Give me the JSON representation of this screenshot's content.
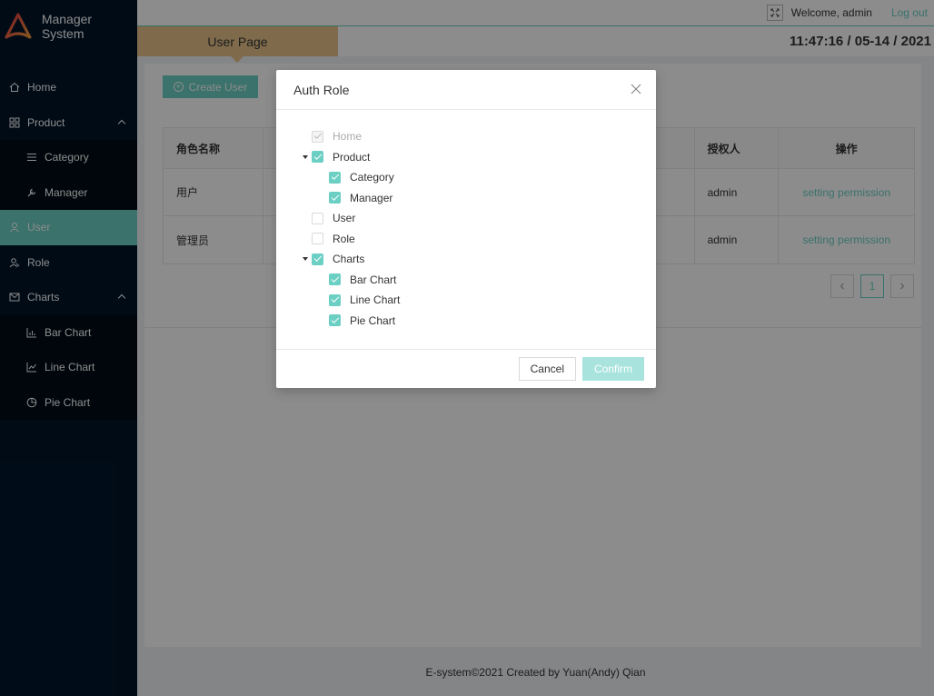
{
  "app": {
    "title": "Manager System"
  },
  "header": {
    "welcome": "Welcome, admin",
    "logout": "Log out",
    "page_title": "User Page",
    "clock": "11:47:16 / 05-14 / 2021"
  },
  "sidebar": {
    "items": [
      {
        "label": "Home"
      },
      {
        "label": "Product"
      },
      {
        "label": "Category"
      },
      {
        "label": "Manager"
      },
      {
        "label": "User"
      },
      {
        "label": "Role"
      },
      {
        "label": "Charts"
      },
      {
        "label": "Bar Chart"
      },
      {
        "label": "Line Chart"
      },
      {
        "label": "Pie Chart"
      }
    ]
  },
  "content": {
    "create_label": "Create User",
    "table": {
      "headers": [
        "角色名称",
        "授权人",
        "操作"
      ],
      "rows": [
        {
          "name": "用户",
          "auth": "admin",
          "action": "setting permission"
        },
        {
          "name": "管理员",
          "auth": "admin",
          "action": "setting permission"
        }
      ]
    },
    "pagination": {
      "current": "1"
    }
  },
  "modal": {
    "title": "Auth Role",
    "tree": [
      {
        "label": "Home",
        "checked": true,
        "disabled": true
      },
      {
        "label": "Product",
        "checked": true
      },
      {
        "label": "Category",
        "checked": true
      },
      {
        "label": "Manager",
        "checked": true
      },
      {
        "label": "User",
        "checked": false
      },
      {
        "label": "Role",
        "checked": false
      },
      {
        "label": "Charts",
        "checked": true
      },
      {
        "label": "Bar Chart",
        "checked": true
      },
      {
        "label": "Line Chart",
        "checked": true
      },
      {
        "label": "Pie Chart",
        "checked": true
      }
    ],
    "cancel_label": "Cancel",
    "confirm_label": "Confirm"
  },
  "footer": {
    "text": "E-system©2021 Created by Yuan(Andy) Qian"
  },
  "colors": {
    "accent": "#6ccfc4",
    "sidebar_bg": "#001529",
    "tab_bg": "#e7c48a"
  }
}
